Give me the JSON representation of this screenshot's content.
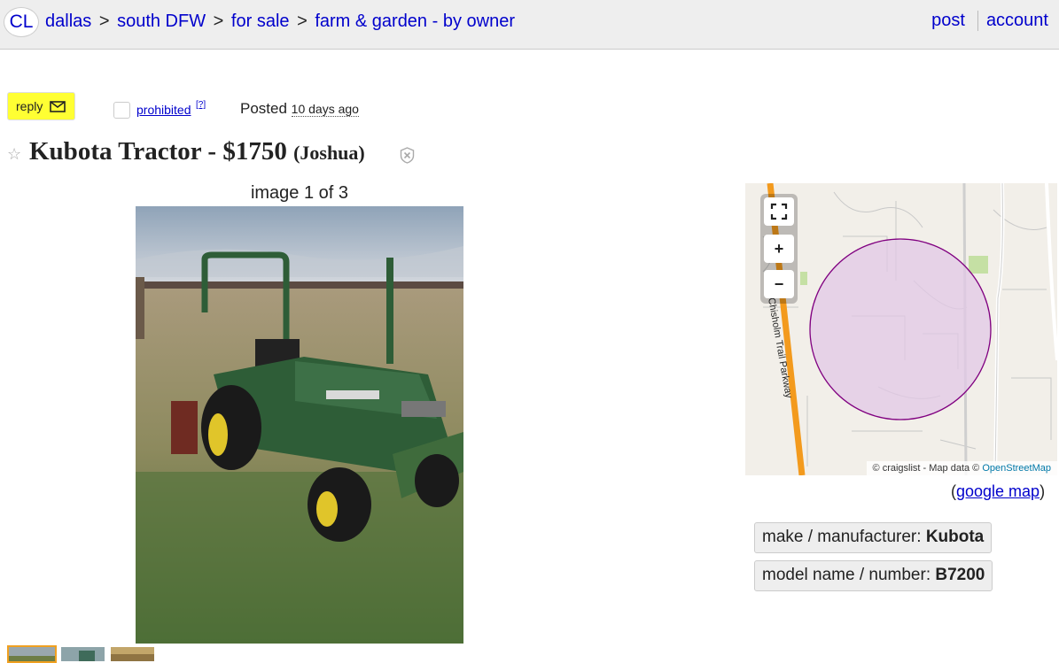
{
  "header": {
    "logo": "CL",
    "breadcrumbs": [
      "dallas",
      "south DFW",
      "for sale",
      "farm & garden - by owner"
    ],
    "separator": ">",
    "post_label": "post",
    "account_label": "account"
  },
  "actions": {
    "reply_label": "reply",
    "prohibited_label": "prohibited",
    "help_label": "[?]",
    "posted_label": "Posted",
    "posted_ago": "10 days ago"
  },
  "listing": {
    "title": "Kubota Tractor",
    "dash": " - ",
    "price": "$1750",
    "location": "(Joshua)"
  },
  "gallery": {
    "counter": "image 1 of 3",
    "thumbnail_count": 3
  },
  "map": {
    "road_label": "Chisholm Trail Parkway",
    "attribution_prefix": "© craigslist - Map data ©",
    "attribution_link": "OpenStreetMap",
    "google_prefix": "(",
    "google_label": "google map",
    "google_suffix": ")",
    "zoom_in": "+",
    "zoom_out": "−"
  },
  "attributes": [
    {
      "label": "make / manufacturer:",
      "value": "Kubota"
    },
    {
      "label": "model name / number:",
      "value": "B7200"
    }
  ],
  "colors": {
    "link": "#0000cc",
    "reply_bg": "#ffff33",
    "tractor_green": "#2e5d37",
    "circle_fill": "#e2c8e6",
    "circle_stroke": "#800080",
    "road": "#f39a1d"
  }
}
